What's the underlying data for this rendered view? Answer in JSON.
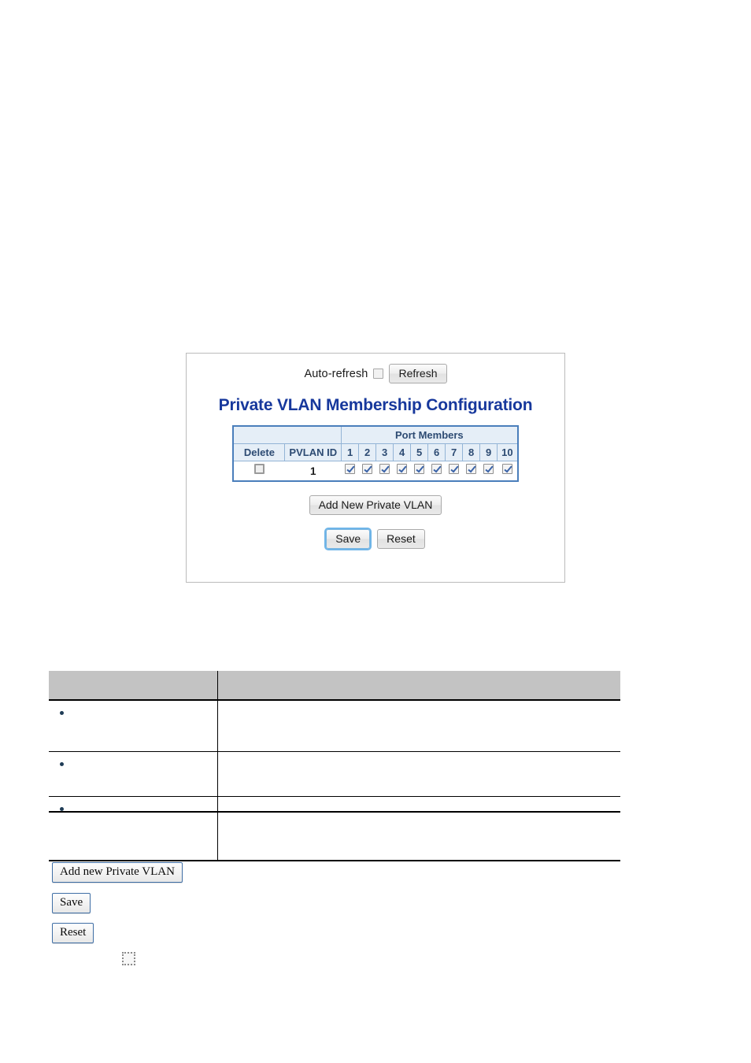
{
  "screenshot_panel": {
    "auto_refresh": {
      "label": "Auto-refresh",
      "checked": false
    },
    "refresh_button": "Refresh",
    "title": "Private VLAN Membership Configuration",
    "table": {
      "group_header": "Port Members",
      "columns": [
        "Delete",
        "PVLAN ID"
      ],
      "port_numbers": [
        "1",
        "2",
        "3",
        "4",
        "5",
        "6",
        "7",
        "8",
        "9",
        "10"
      ],
      "rows": [
        {
          "delete_checked": false,
          "pvlan_id": "1",
          "port_members": [
            true,
            true,
            true,
            true,
            true,
            true,
            true,
            true,
            true,
            true
          ]
        }
      ]
    },
    "add_button": "Add New Private VLAN",
    "save_button": "Save",
    "reset_button": "Reset"
  },
  "doc_table": {
    "header": {
      "left": "",
      "right": ""
    },
    "rows": [
      {
        "left": "",
        "right": ""
      },
      {
        "left": "",
        "right": ""
      },
      {
        "left": "",
        "right": ""
      }
    ]
  },
  "legacy_buttons": {
    "add_new_private_vlan": "Add new Private VLAN",
    "save": "Save",
    "reset": "Reset"
  },
  "colors": {
    "title_blue": "#17389c",
    "table_border_blue": "#4a7ebb",
    "header_fill": "#e5eef7",
    "doc_header_grey": "#c3c3c3",
    "bullet_navy": "#1f3c56",
    "checkmark_blue": "#3a63a8"
  }
}
